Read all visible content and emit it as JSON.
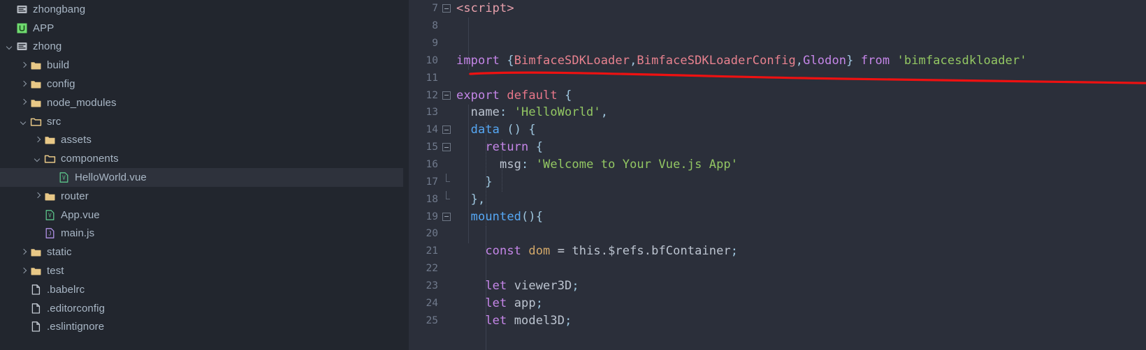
{
  "theme": {
    "sidebar_bg": "#22262e",
    "editor_bg": "#2b2f3a",
    "selection_bg": "#2e323c",
    "text": "#a9b7c6",
    "line_number": "#707a8c",
    "folder_icon": "#e8c887",
    "vue_icon": "#5cc48a",
    "js_icon": "#b292e8",
    "annotation": "#ee1111"
  },
  "sidebar": {
    "items": [
      {
        "label": "zhongbang",
        "icon": "module-icon",
        "indent": 0,
        "arrow": "none",
        "type": "module",
        "selected": false
      },
      {
        "label": "APP",
        "icon": "vue-app-icon",
        "indent": 0,
        "arrow": "none",
        "type": "app",
        "selected": false
      },
      {
        "label": "zhong",
        "icon": "module-icon",
        "indent": 0,
        "arrow": "open",
        "type": "module",
        "selected": false
      },
      {
        "label": "build",
        "icon": "folder-closed-icon",
        "indent": 1,
        "arrow": "closed",
        "type": "folder",
        "selected": false
      },
      {
        "label": "config",
        "icon": "folder-closed-icon",
        "indent": 1,
        "arrow": "closed",
        "type": "folder",
        "selected": false
      },
      {
        "label": "node_modules",
        "icon": "folder-closed-icon",
        "indent": 1,
        "arrow": "closed",
        "type": "folder",
        "selected": false
      },
      {
        "label": "src",
        "icon": "folder-open-icon",
        "indent": 1,
        "arrow": "open",
        "type": "folder",
        "selected": false
      },
      {
        "label": "assets",
        "icon": "folder-closed-icon",
        "indent": 2,
        "arrow": "closed",
        "type": "folder",
        "selected": false
      },
      {
        "label": "components",
        "icon": "folder-open-icon",
        "indent": 2,
        "arrow": "open",
        "type": "folder",
        "selected": false
      },
      {
        "label": "HelloWorld.vue",
        "icon": "vue-file-icon",
        "indent": 3,
        "arrow": "none",
        "type": "file",
        "selected": true
      },
      {
        "label": "router",
        "icon": "folder-closed-icon",
        "indent": 2,
        "arrow": "closed",
        "type": "folder",
        "selected": false
      },
      {
        "label": "App.vue",
        "icon": "vue-file-icon",
        "indent": 2,
        "arrow": "none",
        "type": "file",
        "selected": false
      },
      {
        "label": "main.js",
        "icon": "js-file-icon",
        "indent": 2,
        "arrow": "none",
        "type": "file",
        "selected": false
      },
      {
        "label": "static",
        "icon": "folder-closed-icon",
        "indent": 1,
        "arrow": "closed",
        "type": "folder",
        "selected": false
      },
      {
        "label": "test",
        "icon": "folder-closed-icon",
        "indent": 1,
        "arrow": "closed",
        "type": "folder",
        "selected": false
      },
      {
        "label": ".babelrc",
        "icon": "text-file-icon",
        "indent": 1,
        "arrow": "none",
        "type": "file",
        "selected": false
      },
      {
        "label": ".editorconfig",
        "icon": "text-file-icon",
        "indent": 1,
        "arrow": "none",
        "type": "file",
        "selected": false
      },
      {
        "label": ".eslintignore",
        "icon": "text-file-icon",
        "indent": 1,
        "arrow": "none",
        "type": "file",
        "selected": false
      }
    ]
  },
  "editor": {
    "first_line_number": 7,
    "lines": [
      {
        "n": 7,
        "fold": "minus",
        "text": "<script>"
      },
      {
        "n": 8,
        "fold": "none",
        "text": ""
      },
      {
        "n": 9,
        "fold": "none",
        "text": ""
      },
      {
        "n": 10,
        "fold": "none",
        "text": "import {BimfaceSDKLoader,BimfaceSDKLoaderConfig,Glodon} from 'bimfacesdkloader'"
      },
      {
        "n": 11,
        "fold": "none",
        "text": ""
      },
      {
        "n": 12,
        "fold": "minus",
        "text": "export default {"
      },
      {
        "n": 13,
        "fold": "none",
        "text": "  name: 'HelloWorld',"
      },
      {
        "n": 14,
        "fold": "minus",
        "text": "  data () {"
      },
      {
        "n": 15,
        "fold": "minus",
        "text": "    return {"
      },
      {
        "n": 16,
        "fold": "none",
        "text": "      msg: 'Welcome to Your Vue.js App'"
      },
      {
        "n": 17,
        "fold": "endbr",
        "text": "    }"
      },
      {
        "n": 18,
        "fold": "endbr",
        "text": "  },"
      },
      {
        "n": 19,
        "fold": "minus",
        "text": "  mounted(){"
      },
      {
        "n": 20,
        "fold": "none",
        "text": ""
      },
      {
        "n": 21,
        "fold": "none",
        "text": "    const dom = this.$refs.bfContainer;"
      },
      {
        "n": 22,
        "fold": "none",
        "text": ""
      },
      {
        "n": 23,
        "fold": "none",
        "text": "    let viewer3D;"
      },
      {
        "n": 24,
        "fold": "none",
        "text": "    let app;"
      },
      {
        "n": 25,
        "fold": "none",
        "text": "    let model3D;"
      }
    ]
  },
  "annotation": {
    "type": "hand-drawn-underline",
    "color": "#ee1111",
    "target_line": 10,
    "description": "red underline beneath the import statement"
  }
}
